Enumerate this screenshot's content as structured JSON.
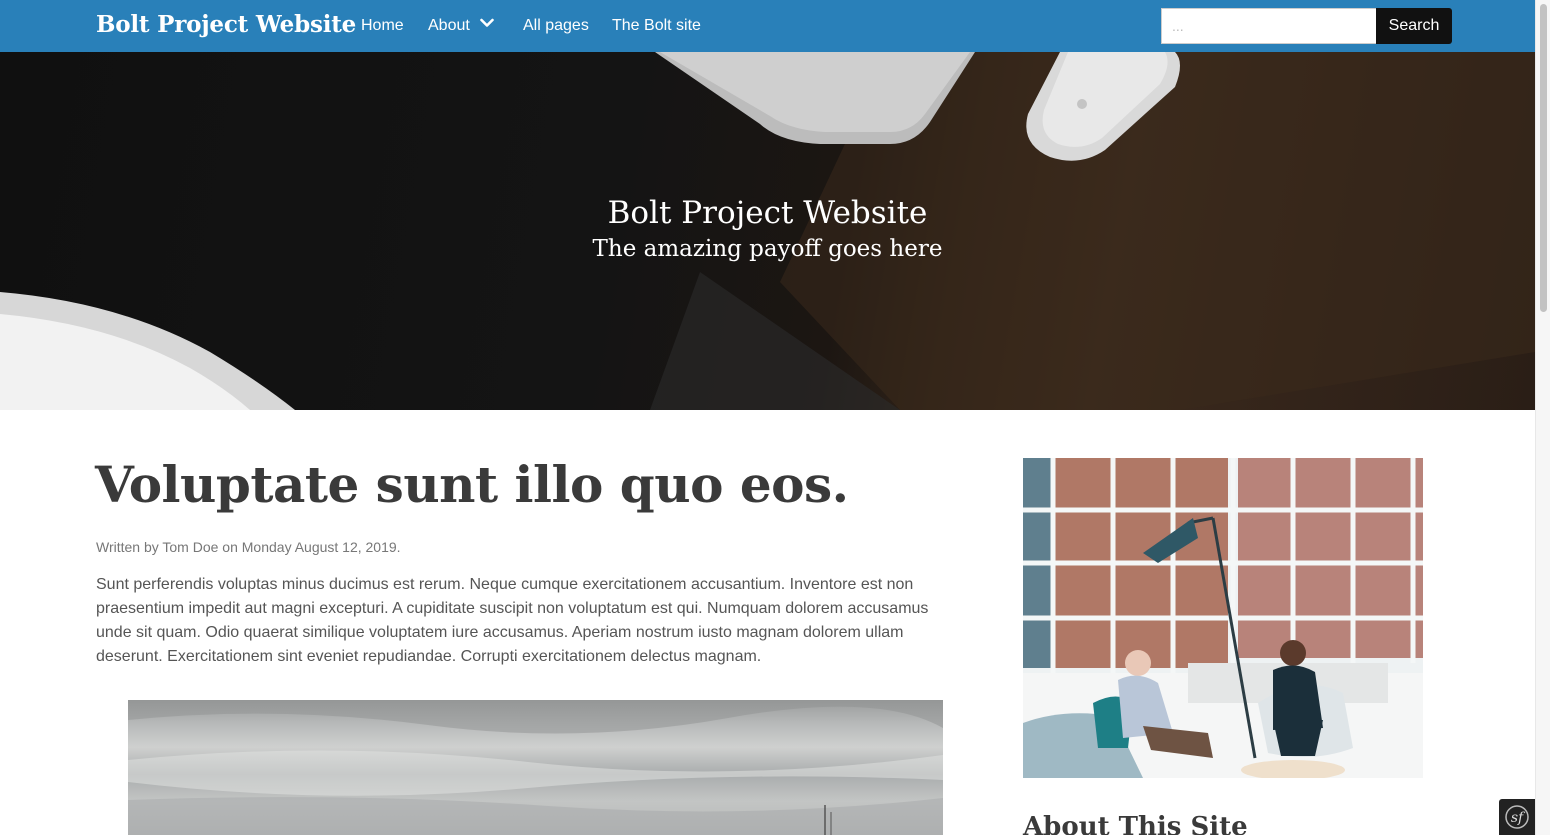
{
  "navbar": {
    "brand": "Bolt Project Website",
    "links": [
      {
        "label": "Home"
      },
      {
        "label": "About",
        "has_dropdown": true
      },
      {
        "label": "All pages"
      },
      {
        "label": "The Bolt site"
      }
    ],
    "search": {
      "placeholder": "...",
      "value": "",
      "button_label": "Search"
    },
    "background_color": "#2980b9"
  },
  "hero": {
    "title": "Bolt Project Website",
    "subtitle": "The amazing payoff goes here"
  },
  "post": {
    "title": "Voluptate sunt illo quo eos.",
    "meta": "Written by Tom Doe on Monday August 12, 2019.",
    "body": "Sunt perferendis voluptas minus ducimus est rerum. Neque cumque exercitationem accusantium. Inventore est non praesentium impedit aut magni excepturi. A cupiditate suscipit non voluptatum est qui. Numquam dolorem accusamus unde sit quam. Odio quaerat similique voluptatem iure accusamus. Aperiam nostrum iusto magnam dolorem ullam deserunt. Exercitationem sint eveniet repudiandae. Corrupti exercitationem delectus magnam."
  },
  "sidebar": {
    "heading": "About This Site"
  },
  "icons": {
    "dropdown": "chevron-down-icon",
    "debug_toolbar": "symfony-icon"
  }
}
